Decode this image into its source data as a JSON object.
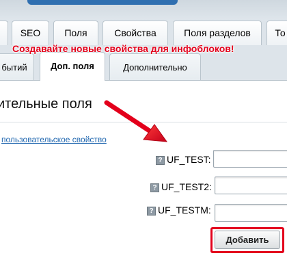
{
  "tabs": [
    {
      "label": ""
    },
    {
      "label": "SEO"
    },
    {
      "label": "Поля"
    },
    {
      "label": "Свойства"
    },
    {
      "label": "Поля разделов"
    },
    {
      "label": "То"
    }
  ],
  "annotation": "Создавайте новые свойства для инфоблоков!",
  "subtabs": [
    {
      "label": "бытий"
    },
    {
      "label": "Доп. поля"
    },
    {
      "label": "Дополнительно"
    }
  ],
  "page_title": "ительные поля",
  "add_property_link": "пользовательское свойство",
  "fields": [
    {
      "label": "UF_TEST:",
      "value": ""
    },
    {
      "label": "UF_TEST2:",
      "value": ""
    },
    {
      "label": "UF_TESTM:",
      "value": ""
    }
  ],
  "help_glyph": "?",
  "add_button_label": "Добавить",
  "colors": {
    "annotation": "#e3001b",
    "link": "#2268b0",
    "highlight_box": "#e3001b"
  }
}
